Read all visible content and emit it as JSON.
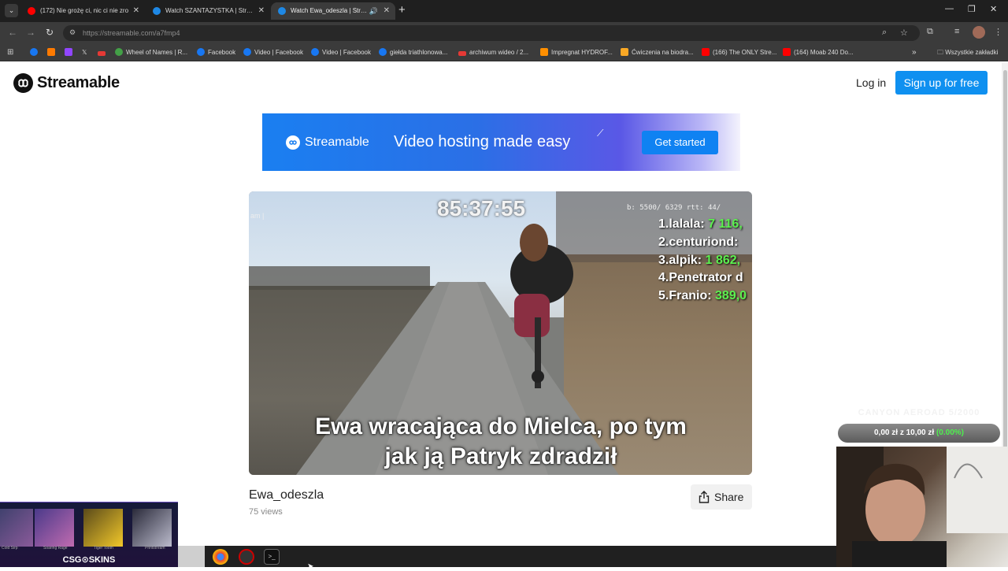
{
  "browser": {
    "tabs": [
      {
        "title": "(172) Nie grożę ci, nic ci nie zro",
        "favicon_color": "#ff0000",
        "active": false
      },
      {
        "title": "Watch SZANTAZYSTKA | Stream",
        "favicon_color": "#1e88e5",
        "active": false
      },
      {
        "title": "Watch Ewa_odeszla | Stream",
        "favicon_color": "#1e88e5",
        "active": true
      }
    ],
    "url_host": "https://streamable.com/",
    "url_path": "a7fmp4",
    "bookmarks": [
      {
        "label": "",
        "color": "#1877f2"
      },
      {
        "label": "",
        "color": "#ff7a00"
      },
      {
        "label": "",
        "color": "#9146ff"
      },
      {
        "label": "𝕏",
        "color": ""
      },
      {
        "label": "",
        "color": "#e53935"
      },
      {
        "label": "Wheel of Names | R...",
        "color": "#43a047"
      },
      {
        "label": "Facebook",
        "color": "#1877f2"
      },
      {
        "label": "Video | Facebook",
        "color": "#1877f2"
      },
      {
        "label": "Video | Facebook",
        "color": "#1877f2"
      },
      {
        "label": "giełda triathlonowa...",
        "color": "#1877f2"
      },
      {
        "label": "archiwum wideo / 2...",
        "color": "#e53935"
      },
      {
        "label": "Impregnat HYDROF...",
        "color": "#ff8f00"
      },
      {
        "label": "Ćwiczenia na biodra...",
        "color": "#f9a825"
      },
      {
        "label": "(166) The ONLY Stre...",
        "color": "#ff0000"
      },
      {
        "label": "(164) Moab 240 Do...",
        "color": "#ff0000"
      }
    ],
    "all_bookmarks": "Wszystkie zakładki"
  },
  "site": {
    "brand": "Streamable",
    "login": "Log in",
    "signup": "Sign up for free"
  },
  "banner": {
    "brand": "Streamable",
    "tagline": "Video hosting made easy",
    "cta": "Get started"
  },
  "video": {
    "timer": "85:37:55",
    "hud_text": "b: 5500/ 6329 rtt: 44/",
    "leaderboard": [
      {
        "rank_name": "1.lalala:",
        "value": "7 116,"
      },
      {
        "rank_name": "2.centuriond:",
        "value": ""
      },
      {
        "rank_name": "3.alpik:",
        "value": "1 862,"
      },
      {
        "rank_name": "4.Penetrator d",
        "value": ""
      },
      {
        "rank_name": "5.Franio:",
        "value": "389,0"
      }
    ],
    "caption": "Ewa wracająca do Mielca, po tym jak ją Patryk zdradził",
    "title": "Ewa_odeszla",
    "views": "75 views",
    "share": "Share"
  },
  "overlay": {
    "csgo_brand": "CSG⊙SKINS",
    "skins": [
      "Cold Sirp",
      "Soaring Rage",
      "Tiger Tooth",
      "Printstream"
    ],
    "donation_title": "CANYON AEROAD 5/2000",
    "donation_amount": "0,00 zł",
    "donation_sep": "z",
    "donation_goal": "10,00 zł",
    "donation_pct": "(0.00%)"
  },
  "colors": {
    "primary": "#0f90f0",
    "chrome_dark": "#1f1f1f",
    "chrome_mid": "#3b3b3b"
  }
}
